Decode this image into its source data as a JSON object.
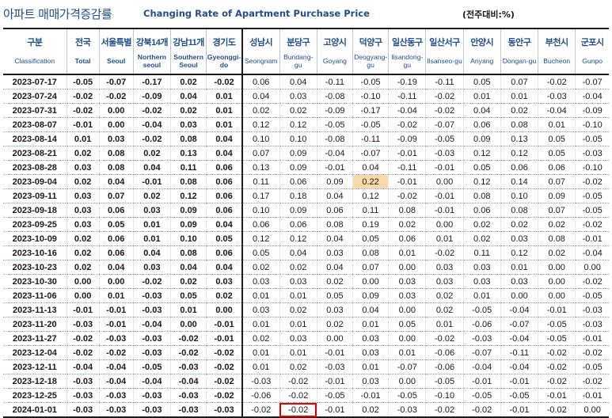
{
  "header": {
    "title_kr": "아파트 매매가격증감률",
    "title_en": "Changing Rate of Apartment Purchase Price",
    "unit": "(전주대비:%)"
  },
  "columns": [
    {
      "kr": "구분",
      "en": "Classification"
    },
    {
      "kr": "전국",
      "en": "Total"
    },
    {
      "kr": "서울특별",
      "en": "Seoul"
    },
    {
      "kr": "강북14개",
      "en": "Northern seoul"
    },
    {
      "kr": "강남11개",
      "en": "Southern Seoul"
    },
    {
      "kr": "경기도",
      "en": "Gyeonggi-do"
    },
    {
      "kr": "성남시",
      "en": "Seongnam"
    },
    {
      "kr": "분당구",
      "en": "Bundang-gu"
    },
    {
      "kr": "고양시",
      "en": "Goyang"
    },
    {
      "kr": "덕양구",
      "en": "Deogyang-gu"
    },
    {
      "kr": "일산동구",
      "en": "Ilsandong-gu"
    },
    {
      "kr": "일산서구",
      "en": "Ilsanseo-gu"
    },
    {
      "kr": "안양시",
      "en": "Anyang"
    },
    {
      "kr": "동안구",
      "en": "Dongan-gu"
    },
    {
      "kr": "부천시",
      "en": "Bucheon"
    },
    {
      "kr": "군포시",
      "en": "Gunpo"
    }
  ],
  "rows": [
    [
      "2023-07-17",
      "-0.05",
      "-0.07",
      "-0.17",
      "0.02",
      "-0.02",
      "0.06",
      "0.04",
      "-0.11",
      "-0.05",
      "-0.19",
      "-0.11",
      "0.05",
      "0.07",
      "-0.02",
      "-0.07"
    ],
    [
      "2023-07-24",
      "-0.02",
      "-0.02",
      "-0.09",
      "0.04",
      "0.01",
      "0.04",
      "0.03",
      "-0.08",
      "-0.10",
      "-0.11",
      "-0.02",
      "0.01",
      "0.01",
      "-0.03",
      "-0.04"
    ],
    [
      "2023-07-31",
      "-0.02",
      "0.00",
      "-0.02",
      "0.02",
      "0.01",
      "0.02",
      "0.02",
      "-0.09",
      "-0.17",
      "-0.04",
      "-0.02",
      "0.04",
      "0.02",
      "-0.04",
      "-0.09"
    ],
    [
      "2023-08-07",
      "-0.01",
      "0.00",
      "-0.04",
      "0.03",
      "0.01",
      "0.12",
      "0.12",
      "-0.05",
      "-0.05",
      "-0.02",
      "-0.07",
      "0.06",
      "0.08",
      "0.01",
      "-0.10"
    ],
    [
      "2023-08-14",
      "0.01",
      "0.03",
      "-0.02",
      "0.08",
      "0.04",
      "0.10",
      "0.10",
      "-0.08",
      "-0.11",
      "-0.09",
      "-0.05",
      "0.09",
      "0.13",
      "0.05",
      "-0.05"
    ],
    [
      "2023-08-21",
      "0.02",
      "0.08",
      "0.02",
      "0.13",
      "0.04",
      "0.07",
      "0.09",
      "-0.04",
      "-0.07",
      "-0.01",
      "-0.03",
      "0.12",
      "0.12",
      "0.05",
      "-0.03"
    ],
    [
      "2023-08-28",
      "0.03",
      "0.08",
      "0.04",
      "0.11",
      "0.06",
      "0.13",
      "0.09",
      "-0.01",
      "0.04",
      "-0.11",
      "-0.01",
      "0.05",
      "0.06",
      "0.06",
      "-0.10"
    ],
    [
      "2023-09-04",
      "0.02",
      "0.04",
      "-0.01",
      "0.08",
      "0.06",
      "0.11",
      "0.06",
      "0.09",
      "0.22",
      "-0.01",
      "0.00",
      "0.12",
      "0.14",
      "0.07",
      "-0.02"
    ],
    [
      "2023-09-11",
      "0.03",
      "0.07",
      "0.02",
      "0.12",
      "0.06",
      "0.17",
      "0.18",
      "0.04",
      "0.12",
      "-0.02",
      "-0.01",
      "0.08",
      "0.10",
      "0.09",
      "-0.05"
    ],
    [
      "2023-09-18",
      "0.03",
      "0.06",
      "0.03",
      "0.09",
      "0.06",
      "0.10",
      "0.09",
      "0.06",
      "0.11",
      "0.08",
      "-0.01",
      "0.06",
      "0.08",
      "0.07",
      "-0.05"
    ],
    [
      "2023-09-25",
      "0.03",
      "0.05",
      "0.01",
      "0.09",
      "0.04",
      "0.06",
      "0.06",
      "0.08",
      "0.19",
      "0.02",
      "0.00",
      "0.02",
      "0.02",
      "0.02",
      "-0.02"
    ],
    [
      "2023-10-09",
      "0.02",
      "0.06",
      "0.01",
      "0.10",
      "0.05",
      "0.12",
      "0.12",
      "0.04",
      "0.05",
      "0.06",
      "0.01",
      "0.02",
      "0.03",
      "0.08",
      "-0.01"
    ],
    [
      "2023-10-16",
      "0.02",
      "0.06",
      "0.04",
      "0.08",
      "0.06",
      "0.05",
      "0.04",
      "0.03",
      "0.08",
      "0.01",
      "-0.02",
      "0.11",
      "0.12",
      "0.02",
      "-0.04"
    ],
    [
      "2023-10-23",
      "0.02",
      "0.04",
      "0.03",
      "0.04",
      "0.04",
      "0.02",
      "0.02",
      "0.04",
      "0.07",
      "0.00",
      "0.03",
      "0.03",
      "0.01",
      "0.00",
      "0.00"
    ],
    [
      "2023-10-30",
      "0.00",
      "0.00",
      "-0.02",
      "0.02",
      "0.03",
      "0.03",
      "0.03",
      "0.02",
      "0.00",
      "0.03",
      "0.03",
      "0.03",
      "0.03",
      "0.00",
      "-0.02"
    ],
    [
      "2023-11-06",
      "0.00",
      "0.01",
      "-0.03",
      "0.05",
      "0.02",
      "0.01",
      "0.01",
      "0.05",
      "0.09",
      "0.03",
      "0.02",
      "0.01",
      "0.00",
      "0.00",
      "-0.05"
    ],
    [
      "2023-11-13",
      "-0.01",
      "-0.01",
      "-0.03",
      "0.01",
      "0.00",
      "0.03",
      "0.02",
      "0.03",
      "0.04",
      "0.00",
      "0.02",
      "-0.05",
      "-0.04",
      "-0.01",
      "-0.03"
    ],
    [
      "2023-11-20",
      "-0.03",
      "-0.01",
      "-0.04",
      "0.00",
      "-0.01",
      "0.01",
      "0.01",
      "0.02",
      "0.01",
      "0.05",
      "0.01",
      "-0.06",
      "-0.07",
      "-0.05",
      "-0.03"
    ],
    [
      "2023-11-27",
      "-0.02",
      "-0.03",
      "-0.03",
      "-0.02",
      "-0.01",
      "0.02",
      "0.03",
      "0.00",
      "0.03",
      "0.00",
      "-0.02",
      "-0.03",
      "-0.04",
      "-0.05",
      "-0.01"
    ],
    [
      "2023-12-04",
      "-0.02",
      "-0.02",
      "-0.03",
      "-0.02",
      "-0.02",
      "0.01",
      "0.01",
      "-0.01",
      "0.03",
      "0.01",
      "-0.06",
      "-0.07",
      "-0.11",
      "-0.02",
      "-0.02"
    ],
    [
      "2023-12-11",
      "-0.04",
      "-0.04",
      "-0.05",
      "-0.03",
      "-0.02",
      "0.01",
      "0.02",
      "-0.03",
      "0.01",
      "-0.07",
      "-0.06",
      "-0.04",
      "-0.04",
      "-0.02",
      "-0.05"
    ],
    [
      "2023-12-18",
      "-0.03",
      "-0.04",
      "-0.04",
      "-0.04",
      "-0.02",
      "-0.03",
      "-0.02",
      "-0.01",
      "0.03",
      "0.00",
      "-0.05",
      "-0.01",
      "-0.01",
      "-0.02",
      "-0.02"
    ],
    [
      "2023-12-25",
      "-0.03",
      "-0.03",
      "-0.03",
      "-0.03",
      "-0.02",
      "-0.06",
      "-0.02",
      "-0.05",
      "-0.01",
      "-0.05",
      "-0.10",
      "-0.05",
      "-0.05",
      "-0.01",
      "-0.01"
    ],
    [
      "2024-01-01",
      "-0.03",
      "-0.03",
      "-0.03",
      "-0.03",
      "-0.03",
      "-0.02",
      "-0.02",
      "-0.01",
      "0.02",
      "-0.03",
      "-0.02",
      "-0.02",
      "-0.01",
      "-0.02",
      "0.00"
    ]
  ],
  "highlights": {
    "shaded_cell": {
      "row": 7,
      "col": 9,
      "color": "#fcd9a6"
    },
    "boxed_cell": {
      "row": 23,
      "col": 7,
      "color": "#e00000"
    }
  }
}
